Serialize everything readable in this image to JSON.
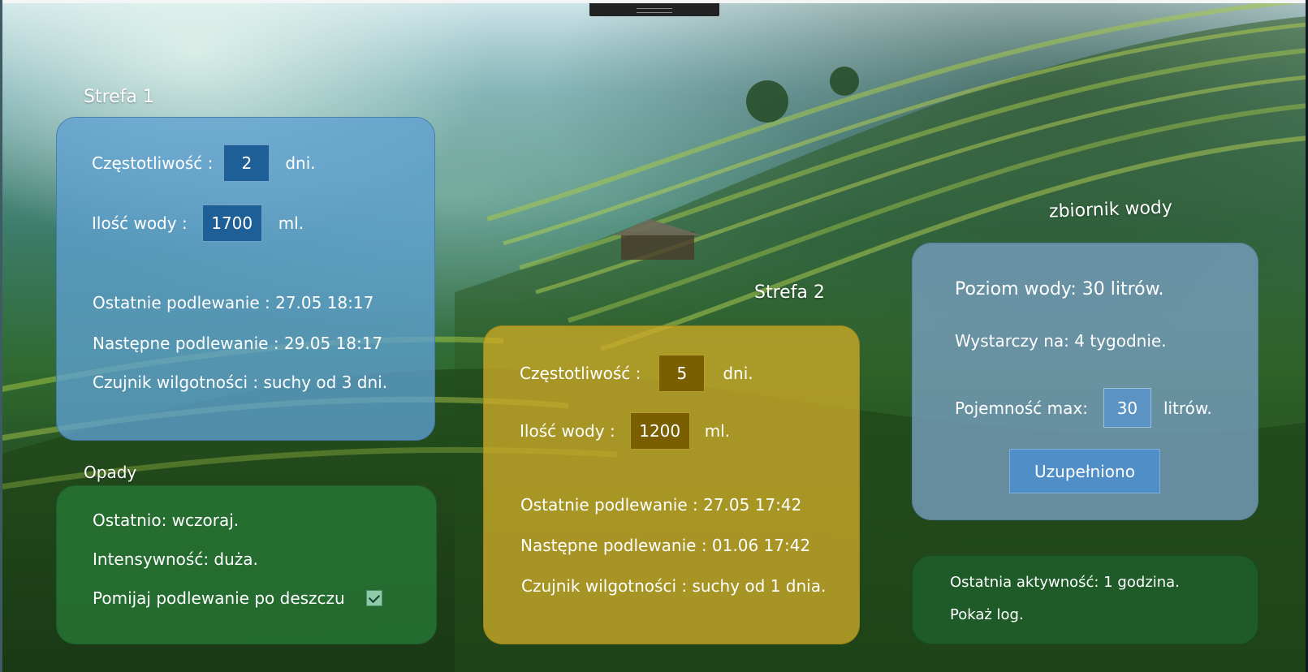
{
  "zone1": {
    "title": "Strefa 1",
    "frequency_label": "Częstotliwość :",
    "frequency_value": "2",
    "frequency_unit": "dni.",
    "water_label": "Ilość wody :",
    "water_value": "1700",
    "water_unit": "ml.",
    "last_watering": "Ostatnie podlewanie : 27.05 18:17",
    "next_watering": "Następne podlewanie : 29.05 18:17",
    "sensor": "Czujnik wilgotności : suchy od 3 dni."
  },
  "rain": {
    "title": "Opady",
    "last": "Ostatnio:  wczoraj.",
    "intensity": "Intensywność:  duża.",
    "skip_label": "Pomijaj podlewanie po deszczu",
    "skip_checked": true
  },
  "zone2": {
    "title": "Strefa 2",
    "frequency_label": "Częstotliwość :",
    "frequency_value": "5",
    "frequency_unit": "dni.",
    "water_label": "Ilość wody :",
    "water_value": "1200",
    "water_unit": "ml.",
    "last_watering": "Ostatnie podlewanie : 27.05 17:42",
    "next_watering": "Następne podlewanie : 01.06 17:42",
    "sensor": "Czujnik wilgotności : suchy od 1 dnia."
  },
  "tank": {
    "title": "zbiornik wody",
    "level": "Poziom wody: 30 litrów.",
    "enough_for": "Wystarczy na: 4 tygodnie.",
    "capacity_label": "Pojemność max:",
    "capacity_value": "30",
    "capacity_unit": "litrów.",
    "refill_button": "Uzupełniono"
  },
  "activity": {
    "last_activity": "Ostatnia aktywność: 1 godzina.",
    "show_log": "Pokaż log."
  },
  "colors": {
    "zone1_panel": "#5fa0d2",
    "zone2_panel": "#cdaa28",
    "rain_panel": "#28783a",
    "tank_panel": "#78a0c3",
    "activity_panel": "#1e5f2d"
  }
}
